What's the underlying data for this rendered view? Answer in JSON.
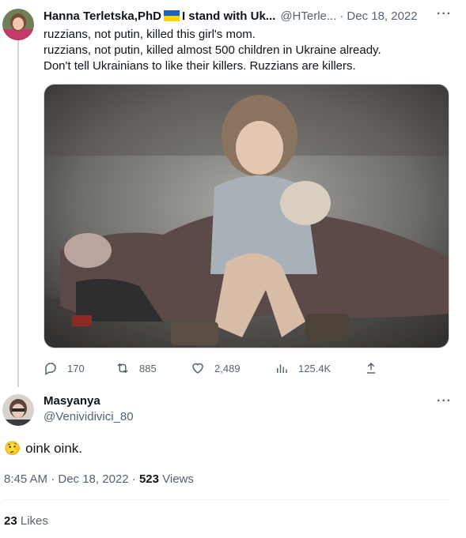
{
  "tweet": {
    "author_name": "Hanna Terletska,PhD",
    "author_bio_suffix": "I stand with Uk...",
    "handle": "@HTerle...",
    "separator": "·",
    "date": "Dec 18, 2022",
    "text_lines": [
      "ruzzians, not putin, killed this girl's mom.",
      "ruzzians, not putin, killed almost 500 children in Ukraine already.",
      "Don't tell Ukrainians to like their killers. Ruzzians are killers."
    ],
    "more_icon": "more-horizontal-icon",
    "actions": {
      "reply_count": "170",
      "retweet_count": "885",
      "like_count": "2,489",
      "views_count": "125.4K"
    }
  },
  "reply": {
    "author_name": "Masyanya",
    "handle": "@Venividivici_80",
    "emoji": "🤥",
    "text": "oink oink.",
    "timestamp": "8:45 AM · Dec 18, 2022 ·",
    "views_count": "523",
    "views_label": "Views",
    "likes_count": "23",
    "likes_label": "Likes"
  },
  "colors": {
    "text_primary": "#0f1419",
    "text_secondary": "#536471",
    "flag_blue": "#1f5fbf",
    "flag_yellow": "#ffd500"
  }
}
